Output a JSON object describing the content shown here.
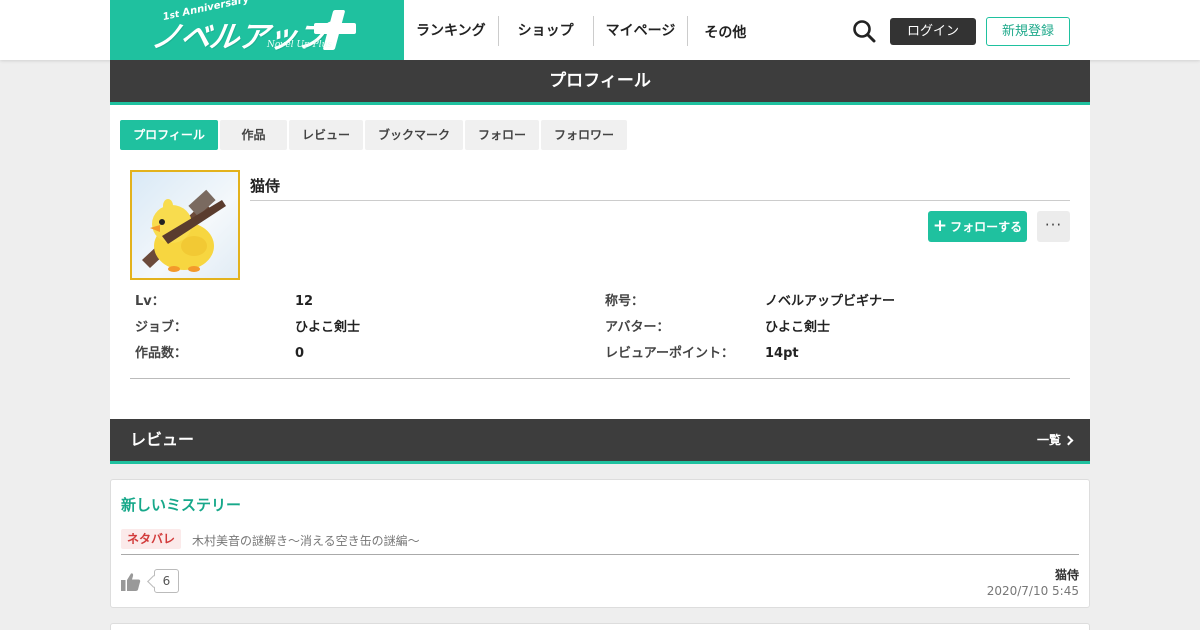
{
  "header": {
    "logo_main": "ノベルアップ",
    "logo_anniv_num": "1",
    "logo_anniv_sup": "st",
    "logo_anniv_text": "Anniversary",
    "logo_sub": "Novel Up Plus",
    "nav": [
      "ランキング",
      "ショップ",
      "マイページ",
      "その他"
    ],
    "login_label": "ログイン",
    "register_label": "新規登録"
  },
  "profile": {
    "heading": "プロフィール",
    "tabs": [
      {
        "label": "プロフィール",
        "active": true
      },
      {
        "label": "作品",
        "active": false
      },
      {
        "label": "レビュー",
        "active": false
      },
      {
        "label": "ブックマーク",
        "active": false
      },
      {
        "label": "フォロー",
        "active": false
      },
      {
        "label": "フォロワー",
        "active": false
      }
    ],
    "username": "猫侍",
    "follow_label": "フォローする",
    "more_label": "···",
    "stats_left": [
      {
        "label": "Lv：",
        "value": "12"
      },
      {
        "label": "ジョブ：",
        "value": "ひよこ剣士"
      },
      {
        "label": "作品数：",
        "value": "0"
      }
    ],
    "stats_right": [
      {
        "label": "称号：",
        "value": "ノベルアップビギナー"
      },
      {
        "label": "アバター：",
        "value": "ひよこ剣士"
      },
      {
        "label": "レビュアーポイント：",
        "value": "14pt"
      }
    ]
  },
  "reviews": {
    "heading": "レビュー",
    "view_all": "一覧",
    "items": [
      {
        "title": "新しいミステリー",
        "spoiler": "ネタバレ",
        "work_title": "木村美音の謎解き〜消える空き缶の謎編〜",
        "likes": "6",
        "author": "猫侍",
        "date": "2020/7/10 5:45"
      }
    ]
  },
  "colors": {
    "brand": "#1fc19f",
    "header_dark": "#3d3d3d",
    "spoiler_text": "#d23b3b"
  }
}
